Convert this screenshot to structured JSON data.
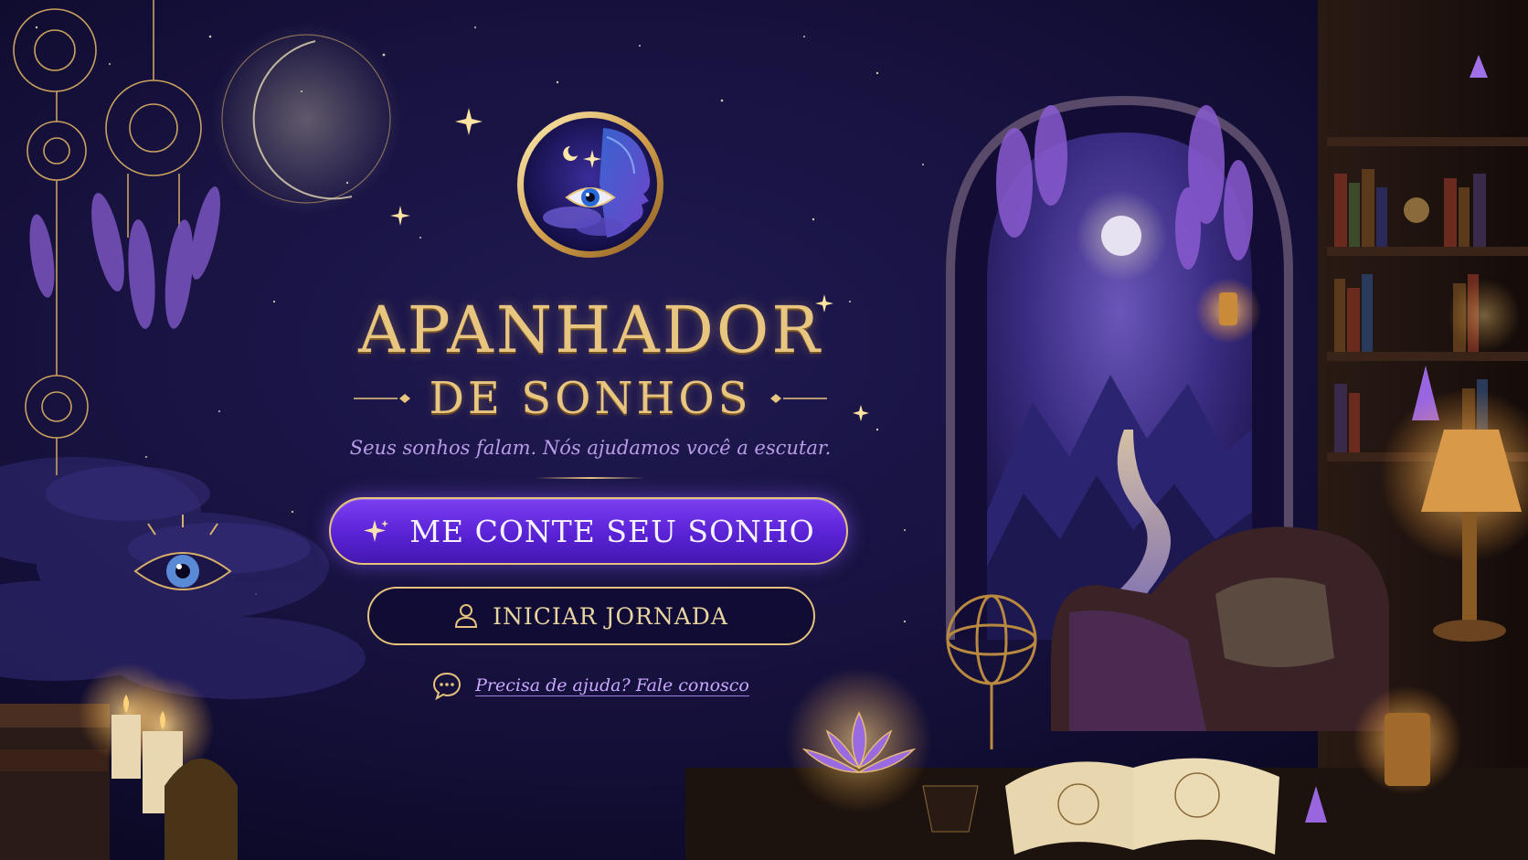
{
  "brand": {
    "title_line1": "APANHADOR",
    "title_line2": "DE SONHOS",
    "tagline": "Seus sonhos falam. Nós ajudamos você a escutar.",
    "emblem_icon": "moon-eye-face-emblem-icon"
  },
  "actions": {
    "primary_label": "ME CONTE SEU SONHO",
    "primary_icon": "sparkle-icon",
    "secondary_label": "INICIAR JORNADA",
    "secondary_icon": "user-icon"
  },
  "help": {
    "link_label": "Precisa de ajuda? Fale conosco",
    "icon": "chat-bubble-icon"
  },
  "colors": {
    "gold": "#e9c680",
    "primary_purple": "#5a22d6",
    "tagline_lavender": "#b99ce8",
    "background_navy": "#0d0a26"
  }
}
